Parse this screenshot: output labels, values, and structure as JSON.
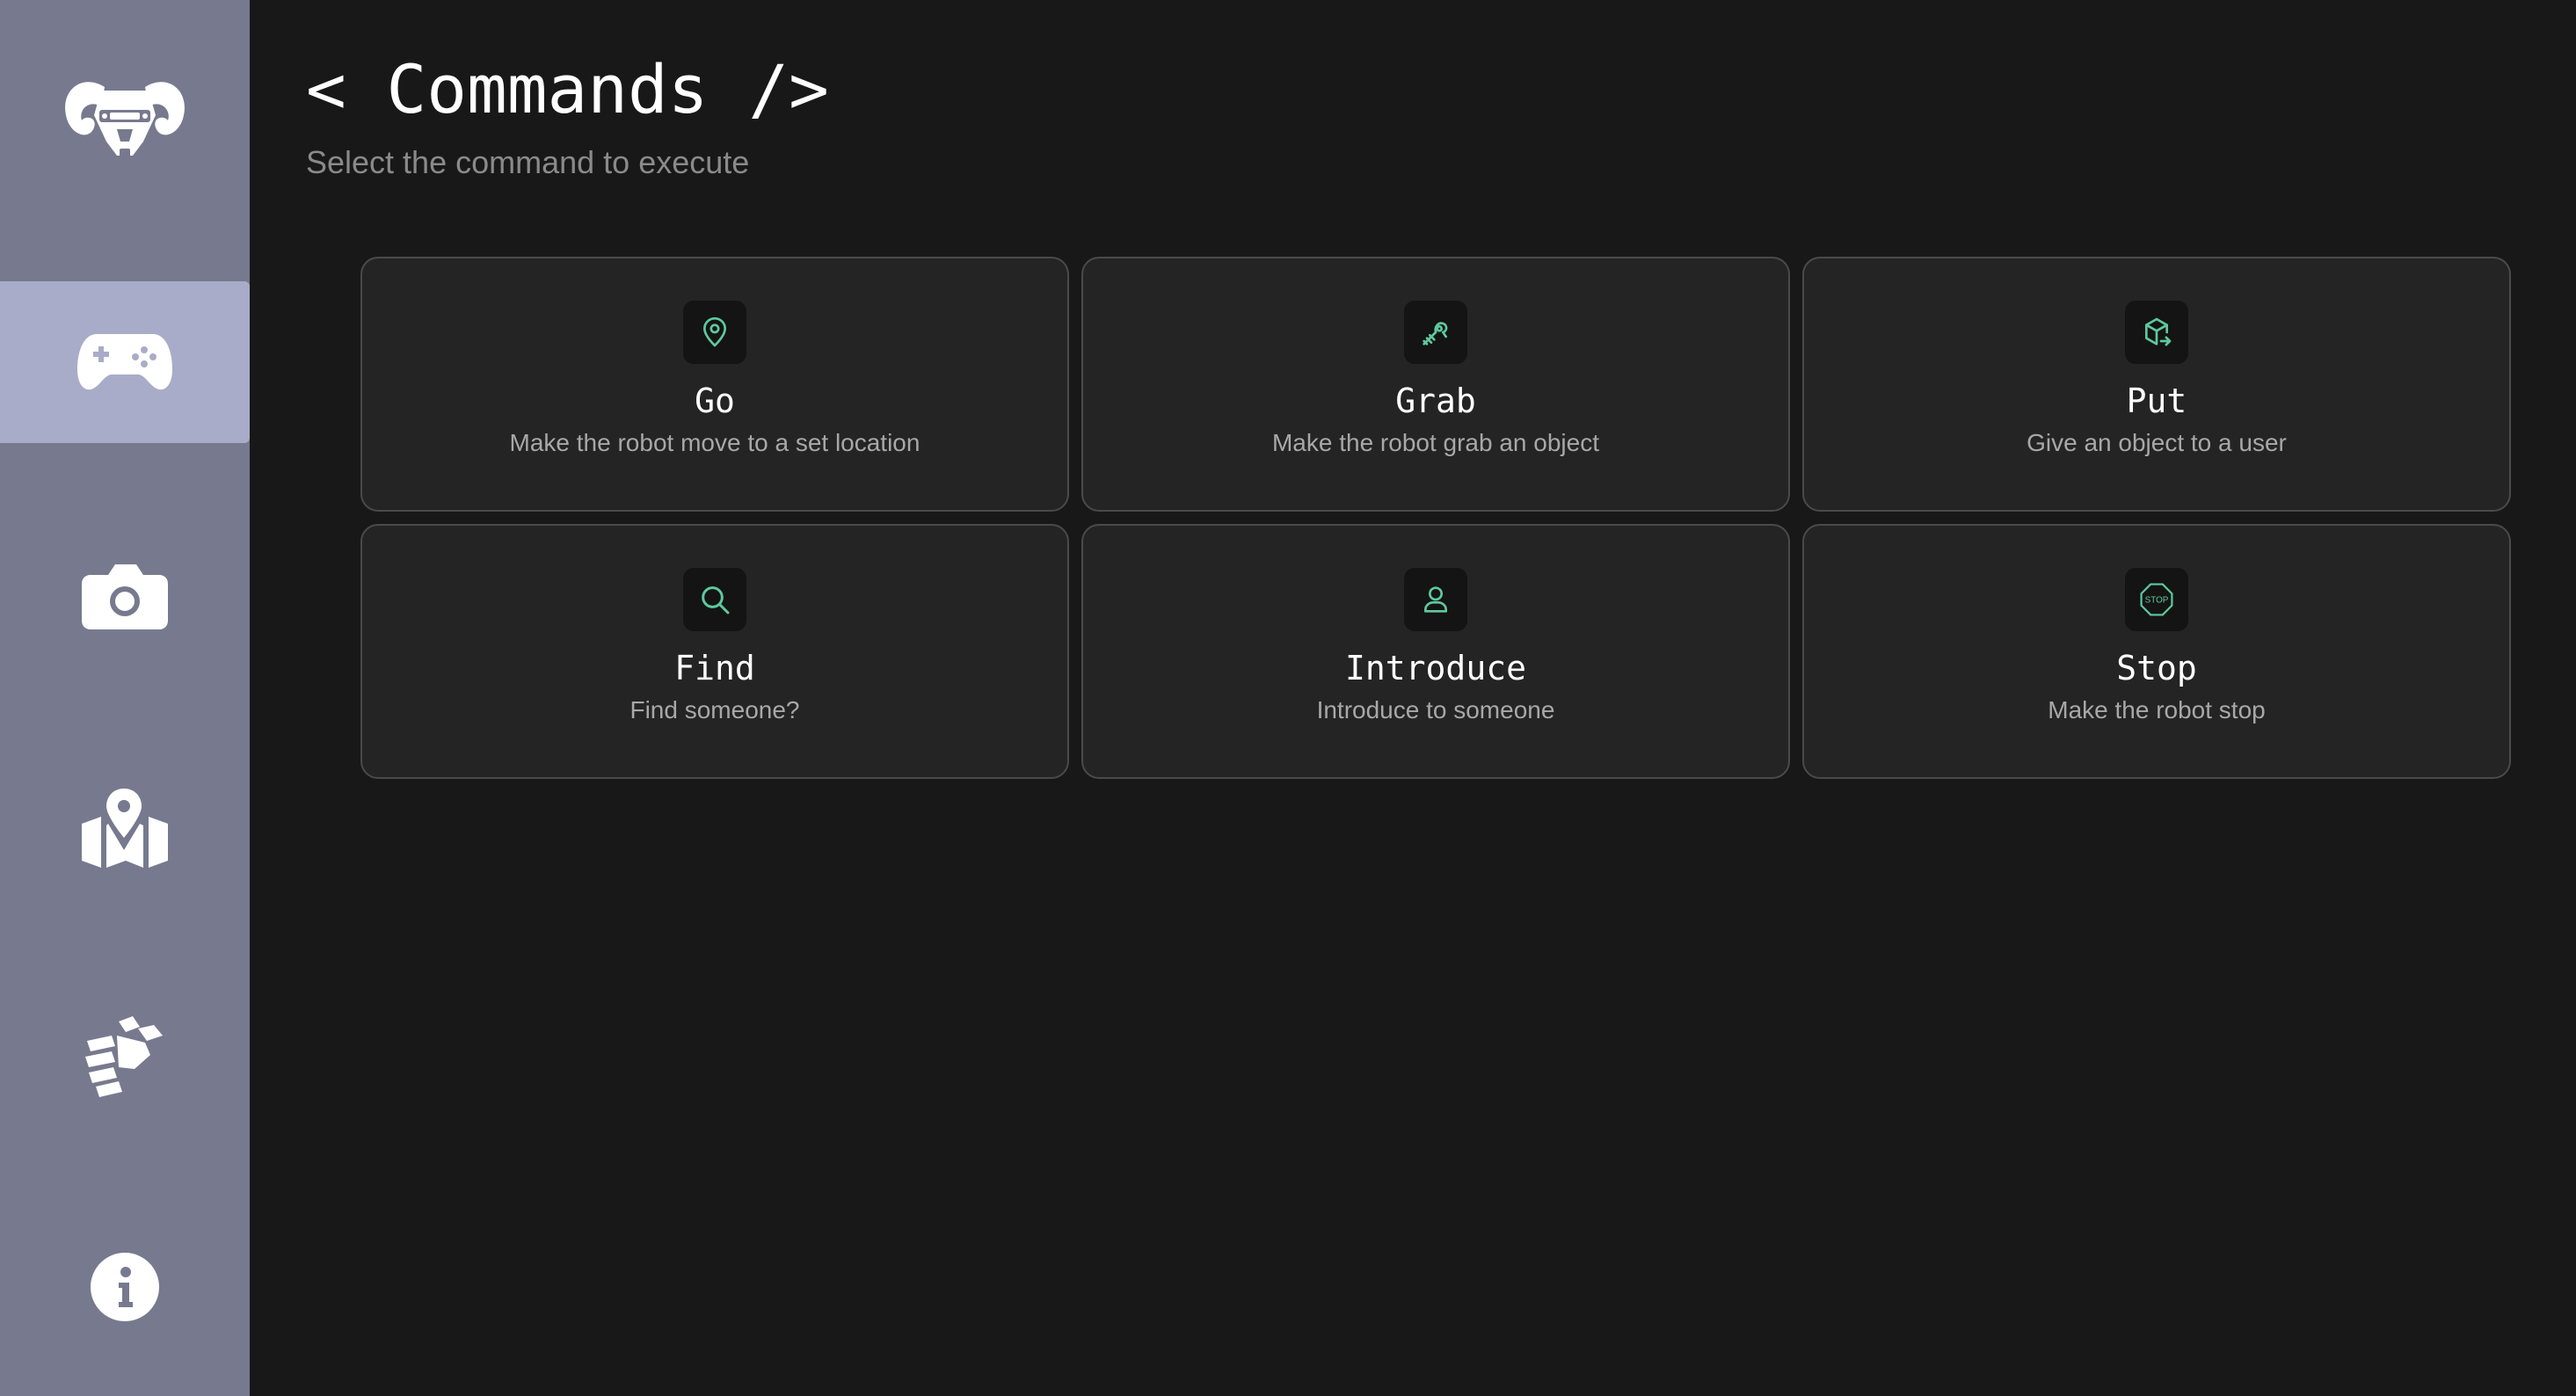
{
  "sidebar": {
    "logo_icon": "ram-robot-logo-icon",
    "items": [
      {
        "id": "commands",
        "icon": "gamepad-icon",
        "active": true
      },
      {
        "id": "camera",
        "icon": "camera-icon",
        "active": false
      },
      {
        "id": "map",
        "icon": "map-icon",
        "active": false
      },
      {
        "id": "arm",
        "icon": "robotic-hand-icon",
        "active": false
      },
      {
        "id": "info",
        "icon": "info-icon",
        "active": false
      }
    ]
  },
  "header": {
    "title": "< Commands />",
    "subtitle": "Select the command to execute"
  },
  "theme": {
    "accent": "#5ec9a0",
    "sidebar_bg": "#777a8e",
    "sidebar_active_bg": "#a8acc8",
    "page_bg": "#181818",
    "card_bg": "#242424"
  },
  "commands": [
    {
      "title": "Go",
      "description": "Make the robot move to a set location",
      "icon": "map-pin-icon"
    },
    {
      "title": "Grab",
      "description": "Make the robot grab an object",
      "icon": "robot-arm-icon"
    },
    {
      "title": "Put",
      "description": "Give an object to a user",
      "icon": "package-export-icon"
    },
    {
      "title": "Find",
      "description": "Find someone?",
      "icon": "search-icon"
    },
    {
      "title": "Introduce",
      "description": "Introduce to someone",
      "icon": "user-icon"
    },
    {
      "title": "Stop",
      "description": "Make the robot stop",
      "icon": "stop-sign-icon",
      "icon_text": "STOP"
    }
  ]
}
